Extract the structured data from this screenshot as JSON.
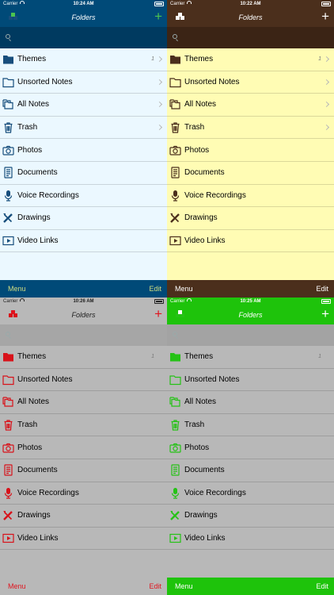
{
  "panels": [
    {
      "status": {
        "carrier": "Carrier",
        "time": "10:24 AM",
        "battery": ""
      },
      "navbar": {
        "title": "Folders",
        "add_label": "+"
      },
      "toolbar": {
        "menu_label": "Menu",
        "edit_label": "Edit"
      },
      "colors": {
        "bar": "#004a78",
        "search": "#003a60",
        "list": "#ebf8ff",
        "accent": "#4cc44f",
        "title": "#ffffff",
        "icon": "#174e7c",
        "barText": "#d0dd80",
        "status": "#ffffff"
      }
    },
    {
      "status": {
        "carrier": "Carrier",
        "time": "10:22 AM",
        "battery": ""
      },
      "navbar": {
        "title": "Folders",
        "add_label": "+"
      },
      "toolbar": {
        "menu_label": "Menu",
        "edit_label": "Edit"
      },
      "colors": {
        "bar": "#4b2f1c",
        "search": "#3b2415",
        "list": "#fffcb4",
        "accent": "#ffffff",
        "title": "#ffffff",
        "icon": "#4b2f1c",
        "barText": "#ffffff",
        "status": "#ffffff"
      }
    },
    {
      "status": {
        "carrier": "Carrier",
        "time": "10:26 AM",
        "battery": ""
      },
      "navbar": {
        "title": "Folders",
        "add_label": "+"
      },
      "toolbar": {
        "menu_label": "Menu",
        "edit_label": "Edit"
      },
      "colors": {
        "bar": "#b8b8b8",
        "search": "#a6a6a6",
        "list": "#b8b8b8",
        "accent": "#e0141e",
        "title": "#222222",
        "icon": "#d8121a",
        "barText": "#e0141e",
        "status": "#222222"
      }
    },
    {
      "status": {
        "carrier": "Carrier",
        "time": "10:25 AM",
        "battery": ""
      },
      "navbar": {
        "title": "Folders",
        "add_label": "+"
      },
      "toolbar": {
        "menu_label": "Menu",
        "edit_label": "Edit"
      },
      "colors": {
        "bar": "#1ec30b",
        "search": "#a3a3a3",
        "list": "#b8b8b8",
        "accent": "#ffffff",
        "title": "#ffffff",
        "icon": "#25c216",
        "barText": "#ffffff",
        "status": "#ffffff"
      }
    }
  ],
  "folders": [
    {
      "label": "Themes",
      "count": "1",
      "icon": "folder-filled-icon"
    },
    {
      "label": "Unsorted Notes",
      "count": "",
      "icon": "folder-outline-icon"
    },
    {
      "label": "All Notes",
      "count": "",
      "icon": "stacked-folders-icon"
    },
    {
      "label": "Trash",
      "count": "",
      "icon": "trash-icon"
    },
    {
      "label": "Photos",
      "count": "",
      "icon": "camera-icon"
    },
    {
      "label": "Documents",
      "count": "",
      "icon": "document-icon"
    },
    {
      "label": "Voice Recordings",
      "count": "",
      "icon": "microphone-icon"
    },
    {
      "label": "Drawings",
      "count": "",
      "icon": "drawing-tools-icon"
    },
    {
      "label": "Video Links",
      "count": "",
      "icon": "video-play-icon"
    }
  ],
  "row_chevrons": [
    true,
    true,
    true,
    true,
    false,
    false,
    false,
    false,
    false
  ]
}
